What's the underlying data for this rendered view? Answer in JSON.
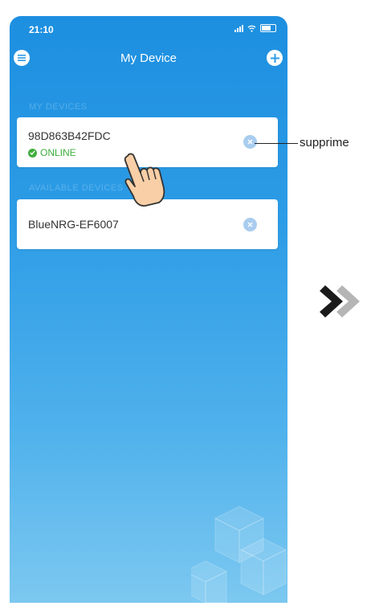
{
  "status_bar": {
    "time": "21:10"
  },
  "nav": {
    "title": "My Device"
  },
  "sections": [
    {
      "label": "MY DEVICES"
    },
    {
      "label": "AVAILABLE DEVICES"
    }
  ],
  "devices": [
    {
      "name": "98D863B42FDC",
      "status": "ONLINE"
    },
    {
      "name": "BlueNRG-EF6007"
    }
  ],
  "annotation": {
    "callout": "supprime"
  },
  "colors": {
    "background_top": "#1d8fe0",
    "background_bottom": "#7cc8f0",
    "online": "#3fae3c",
    "delete_button": "#a9cdef",
    "arrow_dark": "#1a1a1a",
    "arrow_light": "#b5b5b5"
  },
  "icons": {
    "menu": "menu-icon",
    "add": "plus-icon",
    "status": "check-circle-icon",
    "delete": "close-circle-icon",
    "gesture": "tap-hand-icon",
    "next": "double-chevron-right-icon"
  }
}
